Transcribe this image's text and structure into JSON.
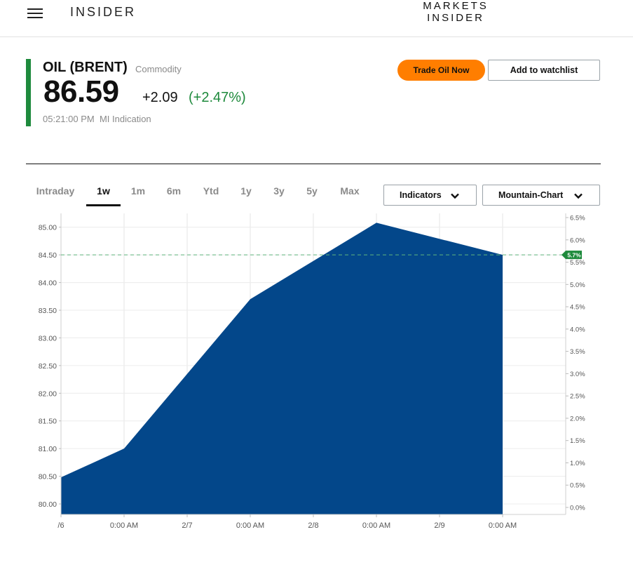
{
  "header": {
    "brand": "INSIDER",
    "logo_line1": "MARKETS",
    "logo_line2": "INSIDER"
  },
  "quote": {
    "name": "OIL (BRENT)",
    "type": "Commodity",
    "price": "86.59",
    "change": "+2.09",
    "change_pct": "(+2.47%)",
    "time": "05:21:00 PM",
    "source": "MI Indication",
    "accent_color": "#1e8a3c"
  },
  "actions": {
    "trade_label": "Trade Oil Now",
    "watch_label": "Add to watchlist",
    "trade_color": "#ff7e00"
  },
  "tabs": [
    {
      "label": "Intraday",
      "active": false
    },
    {
      "label": "1w",
      "active": true
    },
    {
      "label": "1m",
      "active": false
    },
    {
      "label": "6m",
      "active": false
    },
    {
      "label": "Ytd",
      "active": false
    },
    {
      "label": "1y",
      "active": false
    },
    {
      "label": "3y",
      "active": false
    },
    {
      "label": "5y",
      "active": false
    },
    {
      "label": "Max",
      "active": false
    }
  ],
  "dropdowns": {
    "indicators": "Indicators",
    "chart_type": "Mountain-Chart"
  },
  "chart_data": {
    "type": "area",
    "fill_color": "#03478a",
    "x_labels": [
      "/6",
      "0:00 AM",
      "2/7",
      "0:00 AM",
      "2/8",
      "0:00 AM",
      "2/9",
      "0:00 AM"
    ],
    "x_index": [
      0,
      1,
      2,
      3,
      4,
      5,
      6,
      7
    ],
    "series": [
      {
        "x": 0,
        "y": 80.48
      },
      {
        "x": 1,
        "y": 81.0
      },
      {
        "x": 3,
        "y": 83.7
      },
      {
        "x": 5,
        "y": 85.08
      },
      {
        "x": 7,
        "y": 84.5
      }
    ],
    "x_range": [
      0,
      8
    ],
    "y_left_ticks": [
      "80.00",
      "80.50",
      "81.00",
      "81.50",
      "82.00",
      "82.50",
      "83.00",
      "83.50",
      "84.00",
      "84.50",
      "85.00"
    ],
    "y_left_range": [
      79.81,
      85.25
    ],
    "y_right_ticks": [
      "0.0%",
      "0.5%",
      "1.0%",
      "1.5%",
      "2.0%",
      "2.5%",
      "3.0%",
      "3.5%",
      "4.0%",
      "4.5%",
      "5.0%",
      "5.5%",
      "6.0%",
      "6.5%"
    ],
    "reference_value": 84.5,
    "reference_label": "5.7%",
    "reference_color": "#1e8a3c",
    "grid": true
  }
}
